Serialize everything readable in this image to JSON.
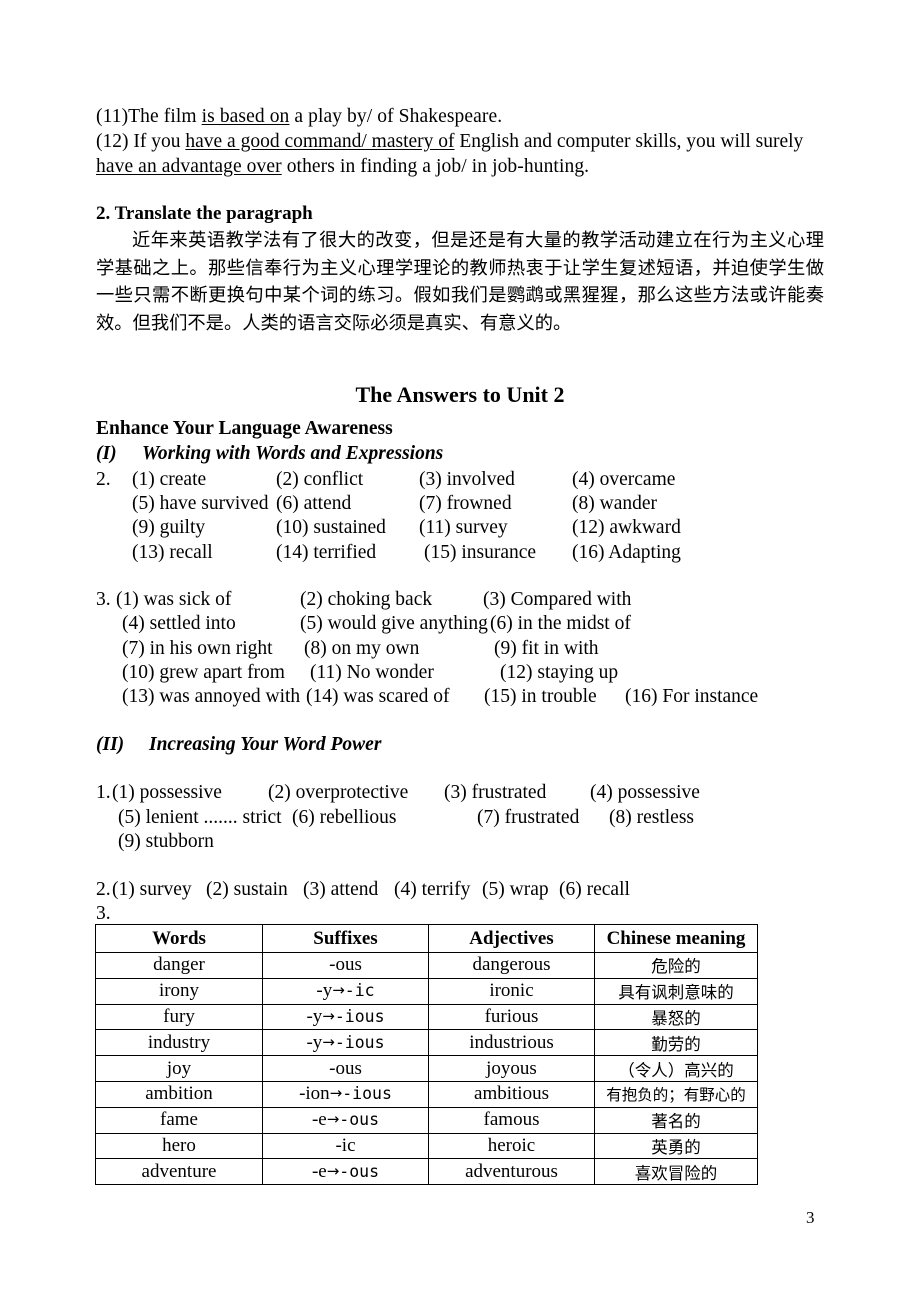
{
  "document": {
    "page_number": "3",
    "title": "The Answers to Unit 2"
  },
  "top_exercises": {
    "item_11": {
      "number": "(11)",
      "before": "The film ",
      "underlined": "is based on",
      "after": " a play by/ of Shakespeare."
    },
    "item_12": {
      "number": "(12)",
      "part1_before": "If you ",
      "part1_underlined": "have a good command/ mastery of",
      "part1_after": " English and computer skills, you will surely",
      "part2_underlined": "have an advantage over",
      "part2_after": " others in finding a job/ in job-hunting."
    }
  },
  "translate_section": {
    "heading": "2. Translate the paragraph",
    "paragraph": "近年来英语教学法有了很大的改变，但是还是有大量的教学活动建立在行为主义心理学基础之上。那些信奉行为主义心理学理论的教师热衷于让学生复述短语，并迫使学生做一些只需不断更换句中某个词的练习。假如我们是鹦鹉或黑猩猩，那么这些方法或许能奏效。但我们不是。人类的语言交际必须是真实、有意义的。"
  },
  "answers": {
    "section_heading": "Enhance Your Language Awareness",
    "part_I": {
      "numeral": "(I)",
      "label": "Working with Words and Expressions",
      "ex2": {
        "number": "2.",
        "rows": [
          [
            "(1) create",
            "(2) conflict",
            "(3) involved",
            "(4) overcame"
          ],
          [
            "(5) have survived",
            "(6) attend",
            "(7) frowned",
            "(8) wander"
          ],
          [
            "(9) guilty",
            "(10) sustained",
            "(11) survey",
            "(12) awkward"
          ],
          [
            "(13) recall",
            "(14) terrified",
            "(15) insurance",
            "(16) Adapting"
          ]
        ]
      },
      "ex3": {
        "number": "3.",
        "rows": [
          [
            "(1) was sick of",
            "(2) choking back",
            "(3) Compared with",
            ""
          ],
          [
            "(4) settled into",
            "(5) would give anything",
            "(6) in the midst of",
            ""
          ],
          [
            "(7) in his own right",
            "(8) on my own",
            "(9) fit in with",
            ""
          ],
          [
            "(10) grew apart from",
            "(11) No wonder",
            "(12) staying up",
            ""
          ],
          [
            "(13) was annoyed with",
            "(14) was scared of",
            "(15) in trouble",
            "(16) For instance"
          ]
        ]
      }
    },
    "part_II": {
      "numeral": "(II)",
      "label": "Increasing Your Word Power",
      "ex1": {
        "number": "1.",
        "rows": [
          [
            "(1) possessive",
            "(2) overprotective",
            "(3) frustrated",
            "(4) possessive"
          ],
          [
            "(5) lenient ....... strict",
            "(6) rebellious",
            "(7) frustrated",
            "(8) restless"
          ],
          [
            "(9) stubborn",
            "",
            "",
            ""
          ]
        ]
      },
      "ex2": {
        "number": "2.",
        "items": [
          "(1) survey",
          "(2) sustain",
          "(3) attend",
          "(4) terrify",
          "(5) wrap",
          "(6) recall"
        ]
      },
      "ex3": {
        "number": "3.",
        "table": {
          "headers": [
            "Words",
            "Suffixes",
            "Adjectives",
            "Chinese meaning"
          ],
          "rows": [
            {
              "word": "danger",
              "suffix_from": "-ous",
              "suffix_arrow": "",
              "suffix_to": "",
              "adjective": "dangerous",
              "chinese": "危险的"
            },
            {
              "word": "irony",
              "suffix_from": "-y",
              "suffix_arrow": "→",
              "suffix_to": "-ic",
              "adjective": "ironic",
              "chinese": "具有讽刺意味的"
            },
            {
              "word": "fury",
              "suffix_from": "-y",
              "suffix_arrow": "→",
              "suffix_to": "-ious",
              "adjective": "furious",
              "chinese": "暴怒的"
            },
            {
              "word": "industry",
              "suffix_from": "-y",
              "suffix_arrow": "→",
              "suffix_to": "-ious",
              "adjective": "industrious",
              "chinese": "勤劳的"
            },
            {
              "word": "joy",
              "suffix_from": "-ous",
              "suffix_arrow": "",
              "suffix_to": "",
              "adjective": "joyous",
              "chinese": "（令人）高兴的"
            },
            {
              "word": "ambition",
              "suffix_from": "-ion",
              "suffix_arrow": "→",
              "suffix_to": "-ious",
              "adjective": "ambitious",
              "chinese": "有抱负的；有野心的"
            },
            {
              "word": "fame",
              "suffix_from": "-e",
              "suffix_arrow": "→",
              "suffix_to": "-ous",
              "adjective": "famous",
              "chinese": "著名的"
            },
            {
              "word": "hero",
              "suffix_from": "-ic",
              "suffix_arrow": "",
              "suffix_to": "",
              "adjective": "heroic",
              "chinese": "英勇的"
            },
            {
              "word": "adventure",
              "suffix_from": "-e",
              "suffix_arrow": "→",
              "suffix_to": "-ous",
              "adjective": "adventurous",
              "chinese": "喜欢冒险的"
            }
          ]
        }
      }
    }
  }
}
